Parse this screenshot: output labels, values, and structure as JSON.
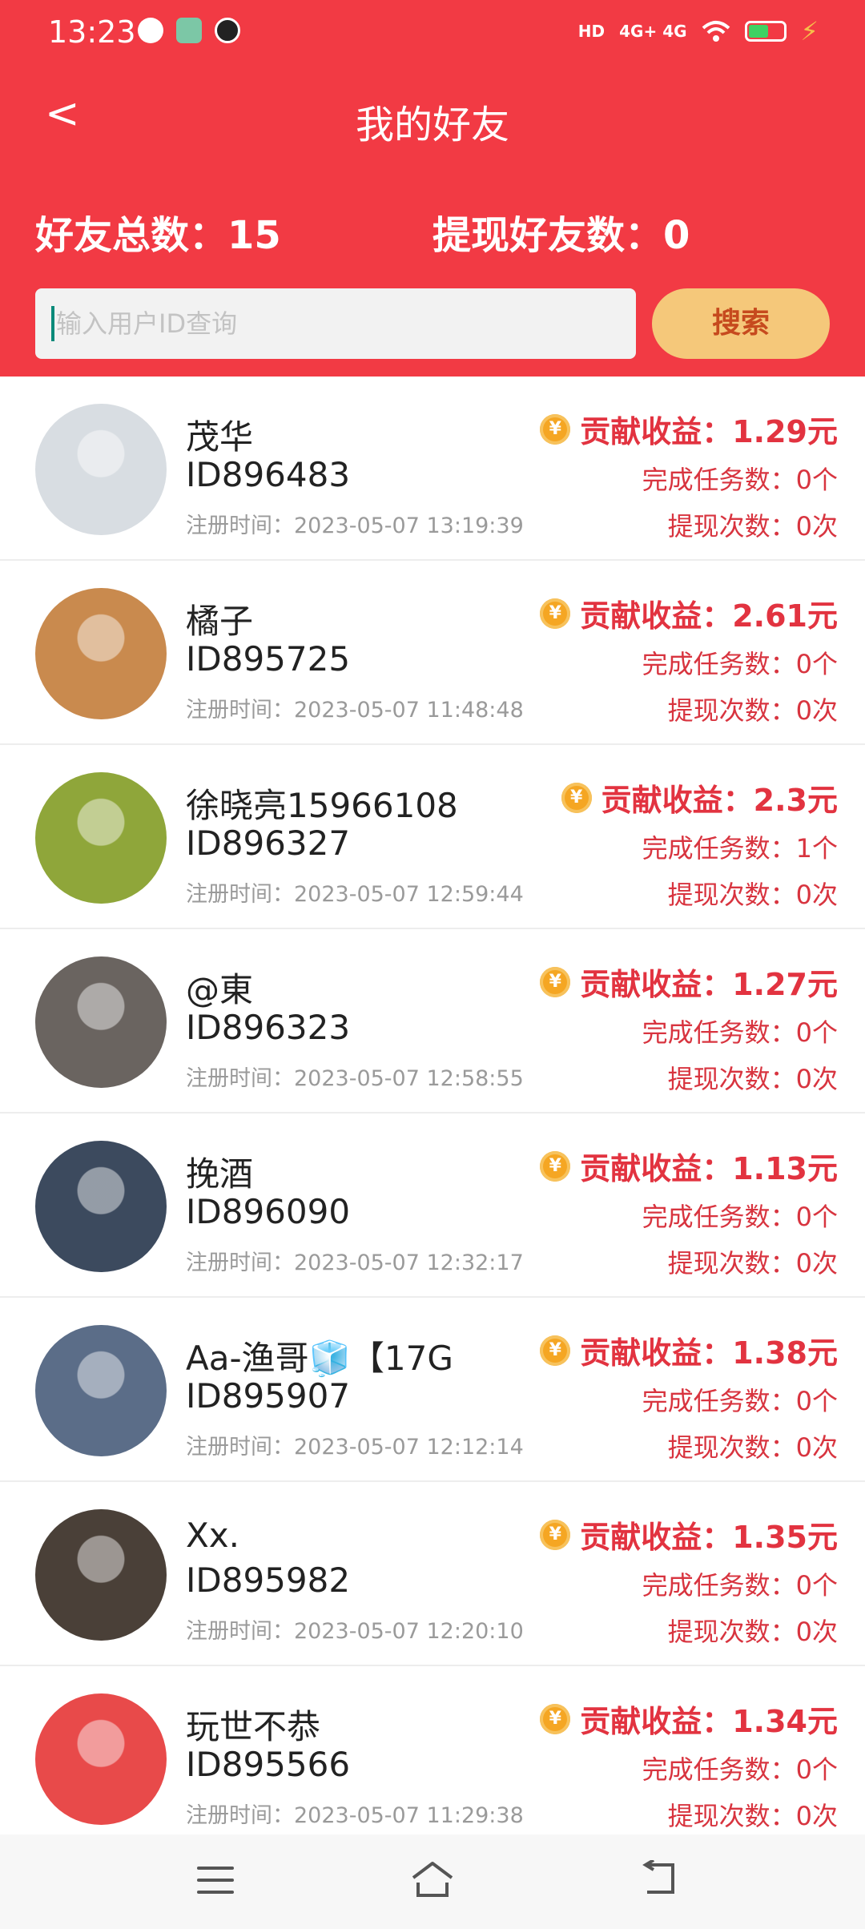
{
  "status_bar": {
    "time": "13:23",
    "network": "4G+ 4G"
  },
  "header": {
    "title": "我的好友",
    "back_glyph": "<"
  },
  "summary": {
    "total": "好友总数：15",
    "withdrawn": "提现好友数：0"
  },
  "search": {
    "placeholder": "输入用户ID查询",
    "button_label": "搜索"
  },
  "friends": [
    {
      "name": "茂华",
      "id": "ID896483",
      "registered": "注册时间：2023-05-07  13:19:39",
      "earnings": "贡献收益：1.29元",
      "tasks": "完成任务数：0个",
      "withdrawals": "提现次数：0次",
      "avatar_color": "#d8dde2"
    },
    {
      "name": "橘子",
      "id": "ID895725",
      "registered": "注册时间：2023-05-07  11:48:48",
      "earnings": "贡献收益：2.61元",
      "tasks": "完成任务数：0个",
      "withdrawals": "提现次数：0次",
      "avatar_color": "#c98a4e"
    },
    {
      "name": "徐晓亮15966108",
      "id": "ID896327",
      "registered": "注册时间：2023-05-07  12:59:44",
      "earnings": "贡献收益：2.3元",
      "tasks": "完成任务数：1个",
      "withdrawals": "提现次数：0次",
      "avatar_color": "#8fa63a"
    },
    {
      "name": "@東",
      "id": "ID896323",
      "registered": "注册时间：2023-05-07  12:58:55",
      "earnings": "贡献收益：1.27元",
      "tasks": "完成任务数：0个",
      "withdrawals": "提现次数：0次",
      "avatar_color": "#6a6460"
    },
    {
      "name": "挽酒",
      "id": "ID896090",
      "registered": "注册时间：2023-05-07  12:32:17",
      "earnings": "贡献收益：1.13元",
      "tasks": "完成任务数：0个",
      "withdrawals": "提现次数：0次",
      "avatar_color": "#3c4a5e"
    },
    {
      "name": "Aa-渔哥🧊【17G",
      "id": "ID895907",
      "registered": "注册时间：2023-05-07  12:12:14",
      "earnings": "贡献收益：1.38元",
      "tasks": "完成任务数：0个",
      "withdrawals": "提现次数：0次",
      "avatar_color": "#5b6d88"
    },
    {
      "name": "Xx.",
      "id": "ID895982",
      "registered": "注册时间：2023-05-07  12:20:10",
      "earnings": "贡献收益：1.35元",
      "tasks": "完成任务数：0个",
      "withdrawals": "提现次数：0次",
      "avatar_color": "#4a4038"
    },
    {
      "name": "玩世不恭",
      "id": "ID895566",
      "registered": "注册时间：2023-05-07  11:29:38",
      "earnings": "贡献收益：1.34元",
      "tasks": "完成任务数：0个",
      "withdrawals": "提现次数：0次",
      "avatar_color": "#e84a4a"
    }
  ],
  "nav": {
    "icons": [
      "menu-icon",
      "home-icon",
      "back-icon"
    ]
  },
  "colors": {
    "brand": "#f23a44",
    "accent_button": "#f5c87a",
    "earnings_text": "#e23340",
    "coin": "#f5a623"
  }
}
